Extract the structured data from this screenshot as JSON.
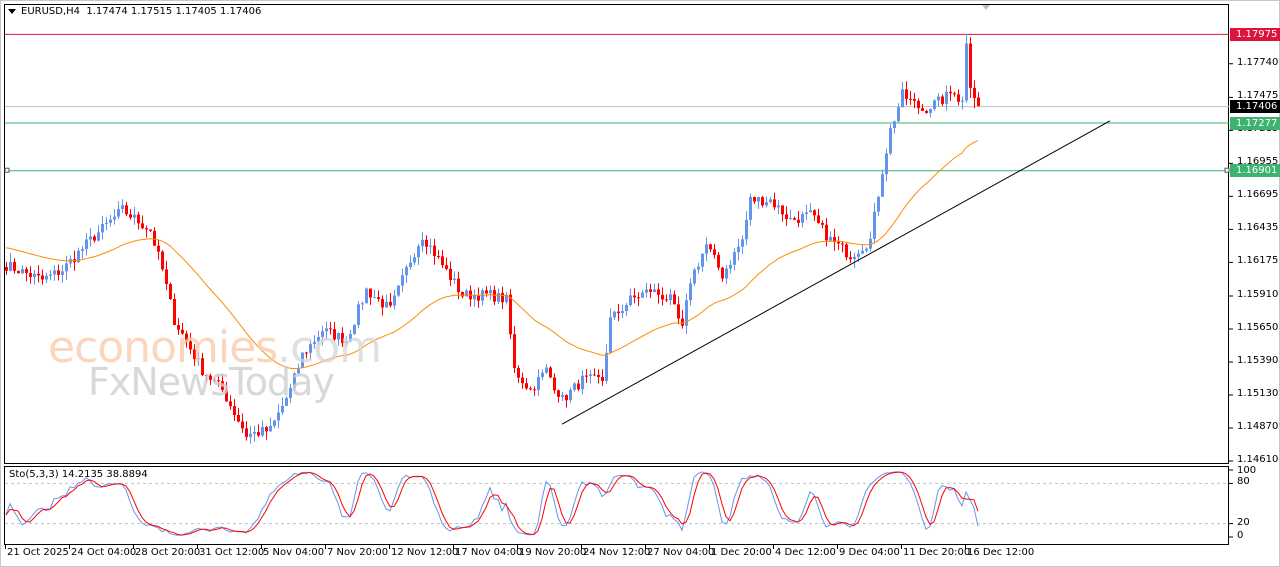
{
  "header": {
    "symbol": "EURUSD,H4",
    "ohlc": "1.17474 1.17515 1.17405 1.17406"
  },
  "watermark": {
    "line1": "economies",
    "line1b": ".com",
    "line2": "FxNewsToday"
  },
  "price_axis": {
    "ticks": [
      "1.17740",
      "1.17475",
      "1.17215",
      "1.16955",
      "1.16695",
      "1.16435",
      "1.16175",
      "1.15910",
      "1.15650",
      "1.15390",
      "1.15130",
      "1.14870",
      "1.14610"
    ],
    "tick_values": [
      1.1774,
      1.17475,
      1.17215,
      1.16955,
      1.16695,
      1.16435,
      1.16175,
      1.1591,
      1.1565,
      1.1539,
      1.1513,
      1.1487,
      1.1461
    ]
  },
  "price_tags": [
    {
      "label": "1.17975",
      "value": 1.17975,
      "color": "#dc143c",
      "line": "#dc143c"
    },
    {
      "label": "1.17406",
      "value": 1.17406,
      "color": "#000000",
      "line": "#c0c0c0"
    },
    {
      "label": "1.17277",
      "value": 1.17277,
      "color": "#3cb371",
      "line": "#3cb371"
    },
    {
      "label": "1.16901",
      "value": 1.16901,
      "color": "#3cb371",
      "line": "#3cb371"
    }
  ],
  "time_axis": [
    "21 Oct 2025",
    "24 Oct 04:00",
    "28 Oct 20:00",
    "31 Oct 12:00",
    "5 Nov 04:00",
    "7 Nov 20:00",
    "12 Nov 12:00",
    "17 Nov 04:00",
    "19 Nov 20:00",
    "24 Nov 12:00",
    "27 Nov 04:00",
    "1 Dec 20:00",
    "4 Dec 12:00",
    "9 Dec 04:00",
    "11 Dec 20:00",
    "16 Dec 12:00"
  ],
  "stochastic": {
    "title": "Sto(5,3,3) 14.2135 38.8894",
    "levels": [
      "100",
      "80",
      "20",
      "0"
    ],
    "level_values": [
      100,
      80,
      20,
      0
    ],
    "main_color": "#ff0000",
    "signal_color": "#6495ed"
  },
  "colors": {
    "up": "#6495ed",
    "down": "#ff0000",
    "ma": "#ff8c00",
    "trendline": "#000000"
  },
  "chart_data": {
    "type": "candlestick",
    "bars": 244,
    "close_waypoints": [
      [
        0,
        1.16154
      ],
      [
        9,
        1.16036
      ],
      [
        14,
        1.16115
      ],
      [
        21,
        1.16351
      ],
      [
        29,
        1.16588
      ],
      [
        36,
        1.1643
      ],
      [
        39,
        1.16115
      ],
      [
        42,
        1.15721
      ],
      [
        49,
        1.15327
      ],
      [
        54,
        1.15169
      ],
      [
        60,
        1.14815
      ],
      [
        66,
        1.14854
      ],
      [
        71,
        1.15169
      ],
      [
        74,
        1.15445
      ],
      [
        79,
        1.15642
      ],
      [
        85,
        1.15563
      ],
      [
        90,
        1.15957
      ],
      [
        96,
        1.158
      ],
      [
        101,
        1.16194
      ],
      [
        104,
        1.16391
      ],
      [
        109,
        1.16154
      ],
      [
        114,
        1.15918
      ],
      [
        121,
        1.15918
      ],
      [
        125,
        1.15879
      ],
      [
        127,
        1.15327
      ],
      [
        131,
        1.15169
      ],
      [
        135,
        1.15327
      ],
      [
        139,
        1.15091
      ],
      [
        144,
        1.15248
      ],
      [
        149,
        1.15248
      ],
      [
        151,
        1.15721
      ],
      [
        156,
        1.15879
      ],
      [
        161,
        1.15957
      ],
      [
        166,
        1.15879
      ],
      [
        169,
        1.15642
      ],
      [
        171,
        1.16036
      ],
      [
        175,
        1.16312
      ],
      [
        179,
        1.16076
      ],
      [
        184,
        1.16351
      ],
      [
        186,
        1.16667
      ],
      [
        191,
        1.16667
      ],
      [
        196,
        1.16509
      ],
      [
        201,
        1.16548
      ],
      [
        206,
        1.16351
      ],
      [
        211,
        1.16233
      ],
      [
        216,
        1.16351
      ],
      [
        219,
        1.16903
      ],
      [
        221,
        1.17218
      ],
      [
        224,
        1.17494
      ],
      [
        229,
        1.17376
      ],
      [
        234,
        1.17455
      ],
      [
        237,
        1.17533
      ],
      [
        239,
        1.174
      ]
    ],
    "last_bars": [
      {
        "o": 1.1745,
        "h": 1.17975,
        "l": 1.1743,
        "c": 1.179
      },
      {
        "o": 1.179,
        "h": 1.1795,
        "l": 1.1747,
        "c": 1.1755
      },
      {
        "o": 1.1755,
        "h": 1.1761,
        "l": 1.1739,
        "c": 1.1747
      },
      {
        "o": 1.17474,
        "h": 1.17515,
        "l": 1.17405,
        "c": 1.17406
      }
    ],
    "ma_period": 40,
    "trendline": {
      "from": [
        139,
        1.149
      ],
      "to": [
        276,
        1.1729
      ]
    }
  }
}
